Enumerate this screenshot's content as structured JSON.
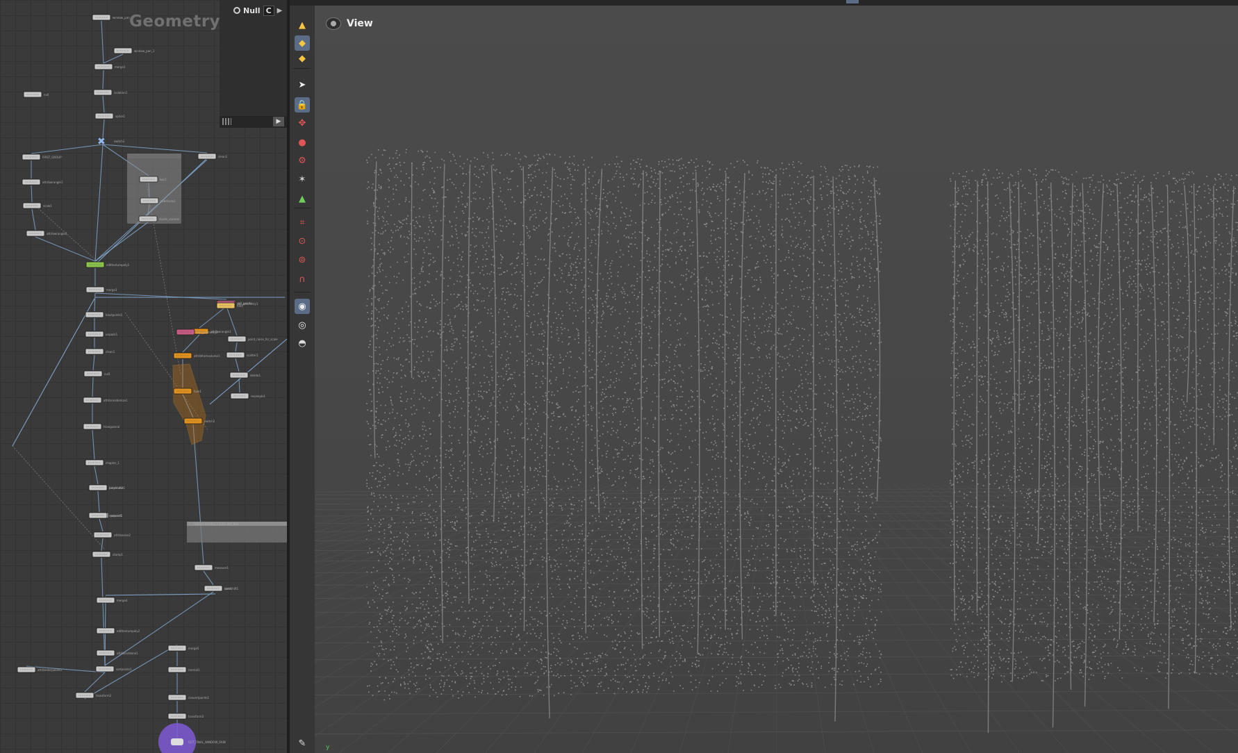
{
  "network": {
    "title": "Geometry",
    "current_node_type": "Null",
    "field_value": "C",
    "nodes": [
      {
        "label": "window_pan_1"
      },
      {
        "label": "window_pan_1"
      },
      {
        "label": "merge1"
      },
      {
        "label": "isolation1"
      },
      {
        "label": "splice1"
      },
      {
        "label": "null"
      },
      {
        "label": "switch1"
      },
      {
        "label": "FIRST_GROUP"
      },
      {
        "label": "attribwrangle1"
      },
      {
        "label": "scale1"
      },
      {
        "label": "attribwrangle2"
      },
      {
        "label": "box1"
      },
      {
        "label": "subdivide1"
      },
      {
        "label": "divide_voronoi"
      },
      {
        "label": "clean1"
      },
      {
        "label": "edittexturepoly1"
      },
      {
        "label": "merge3"
      },
      {
        "label": "blastpoints1"
      },
      {
        "label": "unpack1"
      },
      {
        "label": "clean1"
      },
      {
        "label": "cut1"
      },
      {
        "label": "attribrandomize1"
      },
      {
        "label": "trianguleral"
      },
      {
        "label": "set_points"
      },
      {
        "label": "point_noise_for_scale"
      },
      {
        "label": "scatter1"
      },
      {
        "label": "delete1"
      },
      {
        "label": "resample1"
      },
      {
        "label": "attribwrangle3"
      },
      {
        "label": "attribfromvolume1"
      },
      {
        "label": "fuse1"
      },
      {
        "label": "switch2"
      },
      {
        "label": "chapter_1"
      },
      {
        "label": "polyframe1"
      },
      {
        "label": "popnet1"
      },
      {
        "label": "attribnoise2"
      },
      {
        "label": "stamp1"
      },
      {
        "label": "measure1"
      },
      {
        "label": "sort1"
      },
      {
        "label": "merge4"
      },
      {
        "label": "edittexturepoly2"
      },
      {
        "label": "attribcombine1"
      },
      {
        "label": "attribinterpolate1"
      },
      {
        "label": "sortpoints1"
      },
      {
        "label": "transform2"
      },
      {
        "label": "merge5"
      },
      {
        "label": "normal1"
      },
      {
        "label": "convertpoints1"
      },
      {
        "label": "transform3"
      },
      {
        "label": "rop_geometry1"
      },
      {
        "label": "rop_geometry2"
      },
      {
        "label": "file1"
      },
      {
        "label": "timeshift1"
      },
      {
        "label": "timeshift2"
      },
      {
        "label": "material1"
      },
      {
        "label": "OUT_FINAL_WINDOW_RAIN"
      }
    ],
    "netbox_label": "CREATE DROPLET SEED PER BOX"
  },
  "shelf": {
    "tools": [
      {
        "icon": "sphere-tool-icon",
        "glyph": "▲"
      },
      {
        "icon": "diamond-tool-icon",
        "glyph": "◆"
      },
      {
        "icon": "cube-tool-icon",
        "glyph": "◆"
      },
      {
        "icon": "select-arrow-icon",
        "glyph": "➤"
      },
      {
        "icon": "lock-camera-icon",
        "glyph": "🔒"
      },
      {
        "icon": "handle-tool-icon",
        "glyph": "✥"
      },
      {
        "icon": "paint-tool-icon",
        "glyph": "●"
      },
      {
        "icon": "pose-tool-icon",
        "glyph": "⚙"
      },
      {
        "icon": "skeleton-tool-icon",
        "glyph": "✶"
      },
      {
        "icon": "light-tool-icon",
        "glyph": "▲"
      },
      {
        "icon": "snap-grid-icon",
        "glyph": "⌗"
      },
      {
        "icon": "snap-primitive-icon",
        "glyph": "⊙"
      },
      {
        "icon": "snap-point-icon",
        "glyph": "⊚"
      },
      {
        "icon": "magnet-icon",
        "glyph": "∩"
      },
      {
        "icon": "camera-view-icon",
        "glyph": "◉"
      },
      {
        "icon": "render-region-icon",
        "glyph": "◎"
      },
      {
        "icon": "flipbook-icon",
        "glyph": "◓"
      },
      {
        "icon": "pin-tool-icon",
        "glyph": "✎"
      }
    ]
  },
  "viewport": {
    "title": "View",
    "axis_label": "y"
  },
  "colors": {
    "accent": "#5b6d86",
    "node_orange": "#e0901c",
    "node_green": "#8bc34a",
    "node_pink": "#c55a82",
    "output_ring": "#7f5bd6"
  }
}
